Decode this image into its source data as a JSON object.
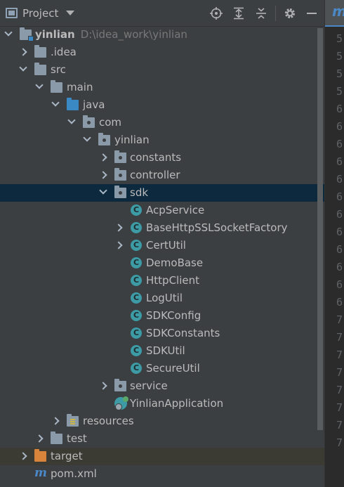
{
  "header": {
    "title": "Project",
    "buttons": [
      "locate-icon",
      "expand-all-icon",
      "collapse-all-icon",
      "gear-icon",
      "minimize-icon"
    ]
  },
  "tree": {
    "root": {
      "label": "yinlian",
      "path": "D:\\idea_work\\yinlian"
    },
    "idea": ".idea",
    "src": "src",
    "main": "main",
    "java": "java",
    "com": "com",
    "yinlian": "yinlian",
    "constants": "constants",
    "controller": "controller",
    "sdk": "sdk",
    "classes": [
      "AcpService",
      "BaseHttpSSLSocketFactory",
      "CertUtil",
      "DemoBase",
      "HttpClient",
      "LogUtil",
      "SDKConfig",
      "SDKConstants",
      "SDKUtil",
      "SecureUtil"
    ],
    "service": "service",
    "app": "YinlianApplication",
    "resources": "resources",
    "test": "test",
    "target": "target",
    "pom": "pom.xml"
  },
  "editor": {
    "tab_letter": "m",
    "line_numbers": [
      "5",
      "5",
      "5",
      "5",
      "6",
      "6",
      "6",
      "6",
      "6",
      "6",
      "6",
      "6",
      "6",
      "6",
      "6",
      "6",
      "7",
      "7",
      "7",
      "7",
      "7",
      "7",
      "7",
      "7"
    ]
  },
  "colors": {
    "background": "#3c3f41",
    "selection": "#0d293e",
    "excluded": "#3c3b33",
    "class_icon": "#3d9ba6",
    "source_folder": "#3a89c4",
    "target_folder": "#d8843a"
  }
}
